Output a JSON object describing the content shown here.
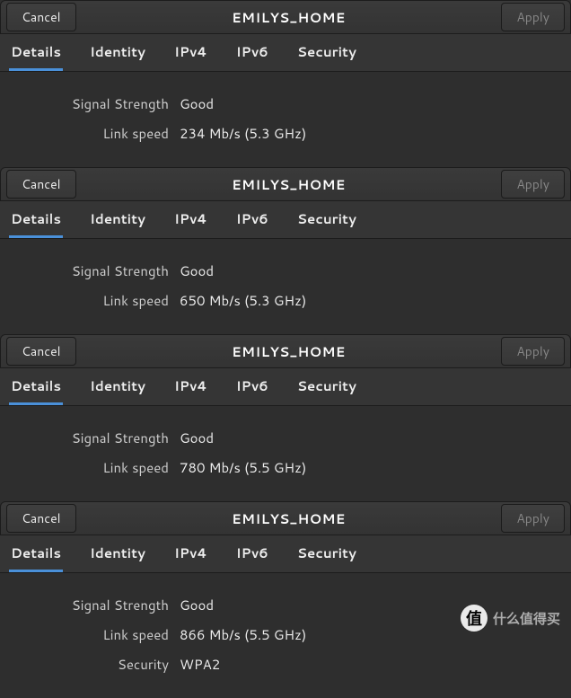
{
  "panels": [
    {
      "cancel": "Cancel",
      "apply": "Apply",
      "title": "EMILYS_HOME",
      "tabs": [
        "Details",
        "Identity",
        "IPv4",
        "IPv6",
        "Security"
      ],
      "active_tab": 0,
      "rows": [
        {
          "label": "Signal Strength",
          "value": "Good"
        },
        {
          "label": "Link speed",
          "value": "234 Mb/s (5.3 GHz)"
        }
      ]
    },
    {
      "cancel": "Cancel",
      "apply": "Apply",
      "title": "EMILYS_HOME",
      "tabs": [
        "Details",
        "Identity",
        "IPv4",
        "IPv6",
        "Security"
      ],
      "active_tab": 0,
      "rows": [
        {
          "label": "Signal Strength",
          "value": "Good"
        },
        {
          "label": "Link speed",
          "value": "650 Mb/s (5.3 GHz)"
        }
      ]
    },
    {
      "cancel": "Cancel",
      "apply": "Apply",
      "title": "EMILYS_HOME",
      "tabs": [
        "Details",
        "Identity",
        "IPv4",
        "IPv6",
        "Security"
      ],
      "active_tab": 0,
      "rows": [
        {
          "label": "Signal Strength",
          "value": "Good"
        },
        {
          "label": "Link speed",
          "value": "780 Mb/s (5.5 GHz)"
        }
      ]
    },
    {
      "cancel": "Cancel",
      "apply": "Apply",
      "title": "EMILYS_HOME",
      "tabs": [
        "Details",
        "Identity",
        "IPv4",
        "IPv6",
        "Security"
      ],
      "active_tab": 0,
      "rows": [
        {
          "label": "Signal Strength",
          "value": "Good"
        },
        {
          "label": "Link speed",
          "value": "866 Mb/s (5.5 GHz)"
        },
        {
          "label": "Security",
          "value": "WPA2"
        }
      ]
    }
  ],
  "watermark": {
    "logo_char": "值",
    "text": "什么值得买"
  }
}
